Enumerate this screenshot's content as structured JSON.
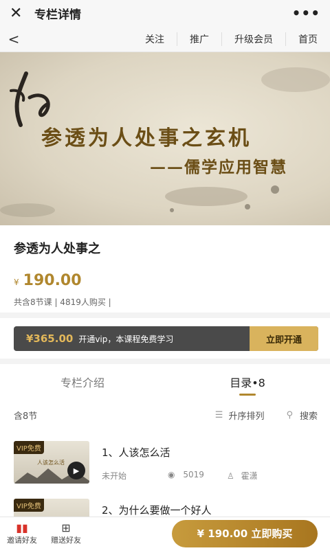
{
  "window": {
    "title": "专栏详情",
    "more_label": "•••"
  },
  "nav": {
    "back_label": "<",
    "links": [
      "关注",
      "推广",
      "升级会员",
      "首页"
    ]
  },
  "banner": {
    "title": "参透为人处事之玄机",
    "subtitle": "——儒学应用智慧"
  },
  "course": {
    "name": "参透为人处事之",
    "currency": "¥",
    "price": "190.00",
    "meta": "共含8节课  |  4819人购买  |"
  },
  "vip": {
    "price": "¥365.00",
    "text": "开通vip，本课程免费学习",
    "button": "立即开通"
  },
  "tabs": [
    {
      "label": "专栏介绍"
    },
    {
      "label": "目录•8"
    }
  ],
  "list": {
    "count_label": "含8节",
    "sort_label": "升序排列",
    "search_label": "搜索",
    "items": [
      {
        "tag": "VIP免费",
        "thumb_caption": "人该怎么活",
        "title": "1、人该怎么活",
        "status": "未开始",
        "views": "5019",
        "author": "霍潇"
      },
      {
        "tag": "VIP免费",
        "thumb_caption": "",
        "title": "2、为什么要做一个好人",
        "status": "",
        "views": "",
        "author": ""
      }
    ]
  },
  "bottom": {
    "invite_label": "邀请好友",
    "gift_label": "赠送好友",
    "buy_label": "¥ 190.00  立即购买"
  },
  "colors": {
    "accent": "#b0872e",
    "vip_bg": "#4a4a4a",
    "vip_btn": "#d9b35d"
  }
}
